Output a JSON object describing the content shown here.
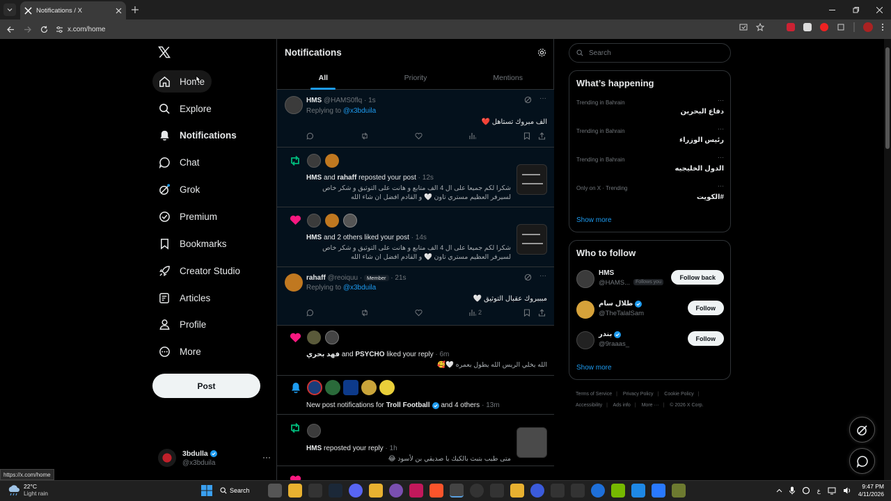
{
  "browser": {
    "tab_title": "Notifications / X",
    "url": "x.com/home",
    "status_url": "https://x.com/home"
  },
  "nav": {
    "items": [
      {
        "label": "Home",
        "icon": "home-icon"
      },
      {
        "label": "Explore",
        "icon": "search-icon"
      },
      {
        "label": "Notifications",
        "icon": "bell-icon"
      },
      {
        "label": "Chat",
        "icon": "chat-icon"
      },
      {
        "label": "Grok",
        "icon": "grok-icon"
      },
      {
        "label": "Premium",
        "icon": "premium-icon"
      },
      {
        "label": "Bookmarks",
        "icon": "bookmark-icon"
      },
      {
        "label": "Creator Studio",
        "icon": "rocket-icon"
      },
      {
        "label": "Articles",
        "icon": "articles-icon"
      },
      {
        "label": "Profile",
        "icon": "profile-icon"
      },
      {
        "label": "More",
        "icon": "more-icon"
      }
    ],
    "post_label": "Post",
    "account": {
      "name": "3bdulla",
      "handle": "@x3bduila"
    }
  },
  "main": {
    "title": "Notifications",
    "tabs": [
      "All",
      "Priority",
      "Mentions"
    ],
    "n1": {
      "name": "HMS",
      "handle": "@HAMS0flq",
      "time": "· 1s",
      "replying": "Replying to",
      "reply_to": "@x3bduila",
      "text": "الف مبروك تستاهل",
      "views": ""
    },
    "n2": {
      "actor1": "HMS",
      "and": "and",
      "actor2": "rahaff",
      "action": "reposted your post",
      "time": "· 12s",
      "line1": "شكرا لكم جميعا على ال 4 الف متابع و هانت على التوثيق و شكر خاص",
      "line2": "لسيرفر العظيم مستري تاون 🤍 و القادم افضل ان شاء الله"
    },
    "n3": {
      "actor1": "HMS",
      "rest": "and 2 others liked your post",
      "time": "· 14s",
      "line1": "شكرا لكم جميعا على ال 4 الف متابع و هانت على التوثيق و شكر خاص",
      "line2": "لسيرفر العظيم مستري تاون 🤍 و القادم افضل ان شاء الله"
    },
    "n4": {
      "name": "rahaff",
      "handle": "@reoiquu",
      "badge": "Member",
      "time": "· 21s",
      "replying": "Replying to",
      "reply_to": "@x3bduila",
      "text": "مبببروك عقبال التوثيق",
      "views": "2"
    },
    "n5": {
      "actor1": "فهد بحري",
      "and": "and",
      "actor2": "PSYCHO",
      "action": "liked your reply",
      "time": "· 6m",
      "text": "الله يخلي الريس الله يطول بعمره 🤍🥰"
    },
    "n6": {
      "prefix": "New post notifications for",
      "name": "Troll Football",
      "rest": "and 4 others",
      "time": "· 13m"
    },
    "n7": {
      "actor1": "HMS",
      "action": "reposted your reply",
      "time": "· 1h",
      "text": "متى طيب بتبث بالكيك يا صديقي بن لأسود 😂"
    }
  },
  "right": {
    "search_placeholder": "Search",
    "happening_title": "What’s happening",
    "trends": [
      {
        "context": "Trending in Bahrain",
        "topic": "دفاع البحرين"
      },
      {
        "context": "Trending in Bahrain",
        "topic": "رئيس الوزراء"
      },
      {
        "context": "Trending in Bahrain",
        "topic": "الدول الخليجيه"
      },
      {
        "context": "Only on X · Trending",
        "topic": "#الكويت"
      }
    ],
    "show_more": "Show more",
    "follow_title": "Who to follow",
    "follows": [
      {
        "name": "HMS",
        "handle": "@HAMS...",
        "tag": "Follows you",
        "button": "Follow back",
        "verified": false
      },
      {
        "name": "طلال سام",
        "handle": "@TheTalalSam",
        "tag": "",
        "button": "Follow",
        "verified": true
      },
      {
        "name": "بندر",
        "handle": "@9raaas_",
        "tag": "",
        "button": "Follow",
        "verified": true
      }
    ],
    "footer": [
      "Terms of Service",
      "Privacy Policy",
      "Cookie Policy",
      "Accessibility",
      "Ads info",
      "More ···",
      "© 2026 X Corp."
    ]
  },
  "taskbar": {
    "temp": "22°C",
    "weather": "Light rain",
    "search": "Search",
    "time": "9:47 PM",
    "date": "4/11/2026",
    "lang": "ع"
  },
  "colors": {
    "accent": "#1d9bf0",
    "like": "#f91880",
    "repost": "#00ba7c"
  }
}
